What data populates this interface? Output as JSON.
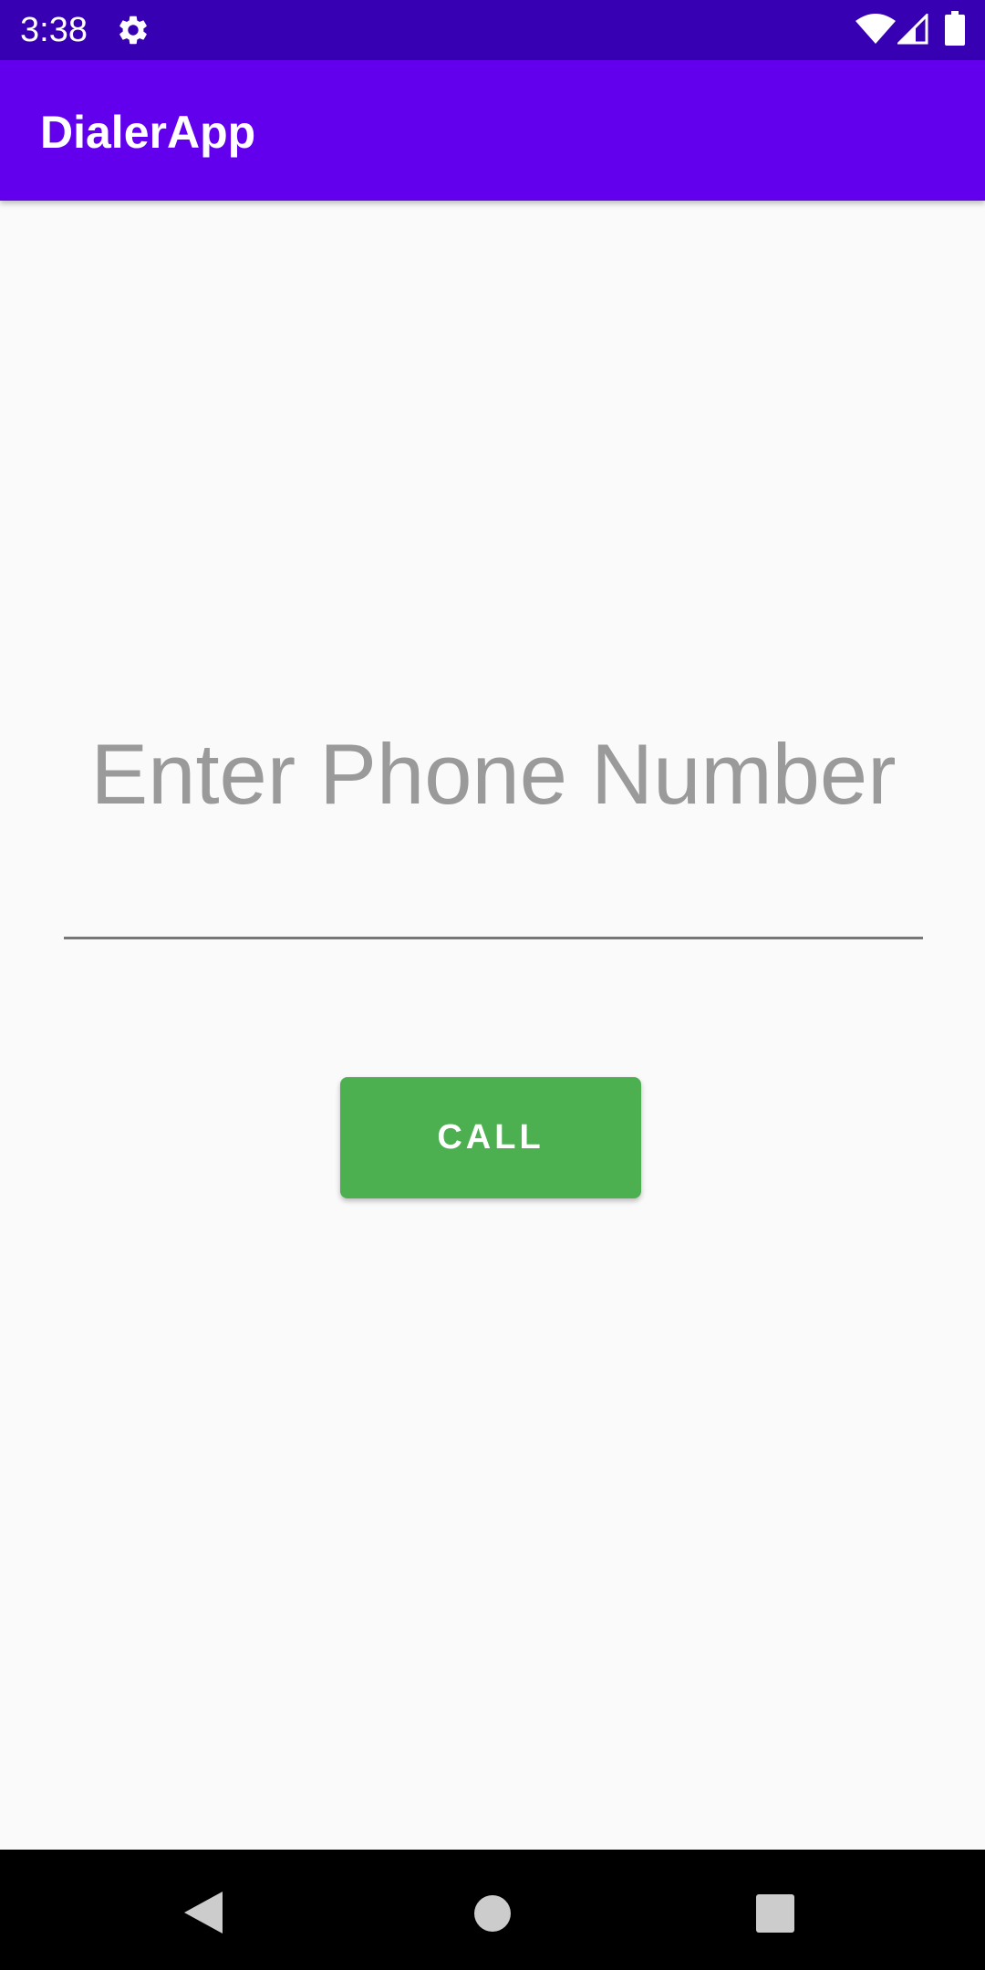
{
  "status_bar": {
    "time": "3:38",
    "icons": [
      "gear-icon",
      "wifi-icon",
      "signal-icon",
      "battery-icon"
    ]
  },
  "app_bar": {
    "title": "DialerApp"
  },
  "phone_input": {
    "value": "",
    "placeholder": "Enter Phone Number"
  },
  "call_button": {
    "label": "CALL",
    "color": "#4caf50"
  },
  "nav_bar": {
    "icons": [
      "back-icon",
      "home-icon",
      "recents-icon"
    ]
  },
  "colors": {
    "status_bar": "#3700b3",
    "app_bar": "#6200ee",
    "background": "#fafafa"
  }
}
